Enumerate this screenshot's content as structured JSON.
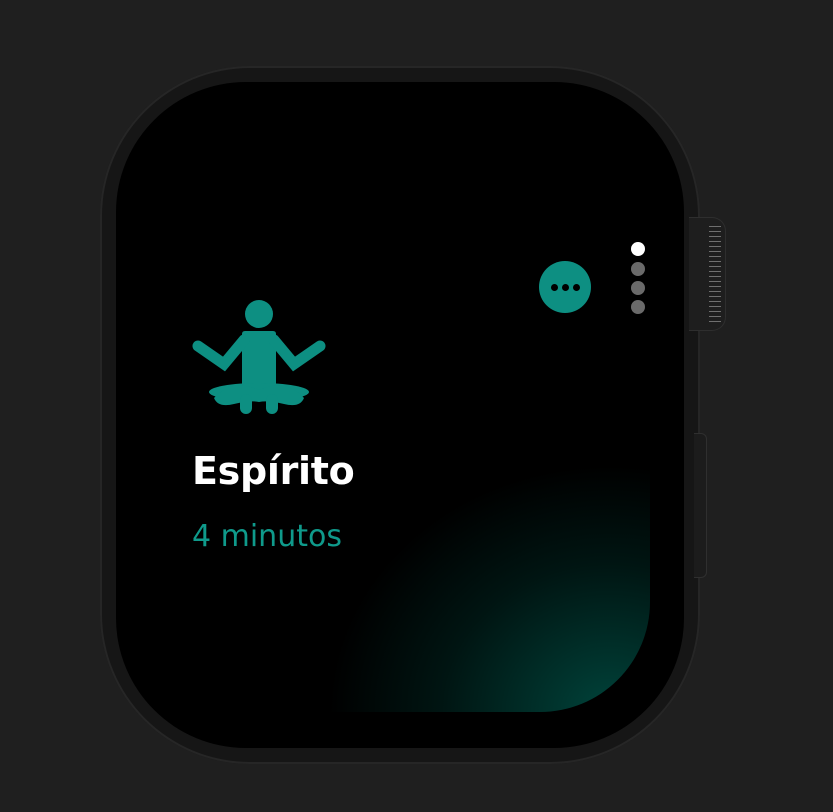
{
  "watch": {
    "accent_color": "#0d8f82",
    "background_color": "#000000"
  },
  "workout": {
    "icon": "meditation-person-icon",
    "title": "Espírito",
    "duration": "4 minutos"
  },
  "more_button": {
    "icon": "ellipsis-icon"
  },
  "page_indicator": {
    "total": 4,
    "current": 1
  }
}
